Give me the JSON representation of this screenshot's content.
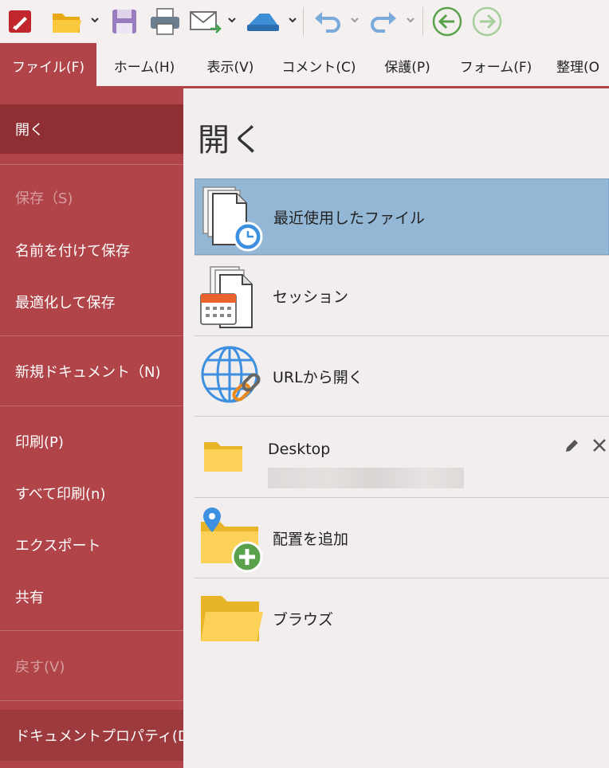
{
  "colors": {
    "accent": "#b04448",
    "selected_side": "#8f2f33",
    "selected_row": "#94b7d6"
  },
  "toolbar": {
    "icons": [
      "app-logo-icon",
      "open-folder-icon",
      "save-icon",
      "print-icon",
      "email-icon",
      "scanner-icon",
      "undo-icon",
      "redo-icon",
      "back-icon",
      "forward-icon"
    ]
  },
  "tabs": [
    "ファイル(F)",
    "ホーム(H)",
    "表示(V)",
    "コメント(C)",
    "保護(P)",
    "フォーム(F)",
    "整理(O"
  ],
  "sidebar": {
    "items": [
      {
        "label": "開く"
      },
      {
        "label": "保存（S)"
      },
      {
        "label": "名前を付けて保存"
      },
      {
        "label": "最適化して保存"
      },
      {
        "label": "新規ドキュメント（N)"
      },
      {
        "label": "印刷(P)"
      },
      {
        "label": "すべて印刷(n)"
      },
      {
        "label": "エクスポート"
      },
      {
        "label": "共有"
      },
      {
        "label": "戻す(V)"
      },
      {
        "label": "ドキュメントプロパティ(D)"
      }
    ]
  },
  "main": {
    "title": "開く",
    "recent": "最近使用したファイル",
    "session": "セッション",
    "url": "URLから開く",
    "desktop": "Desktop",
    "add_location": "配置を追加",
    "browse": "ブラウズ"
  }
}
